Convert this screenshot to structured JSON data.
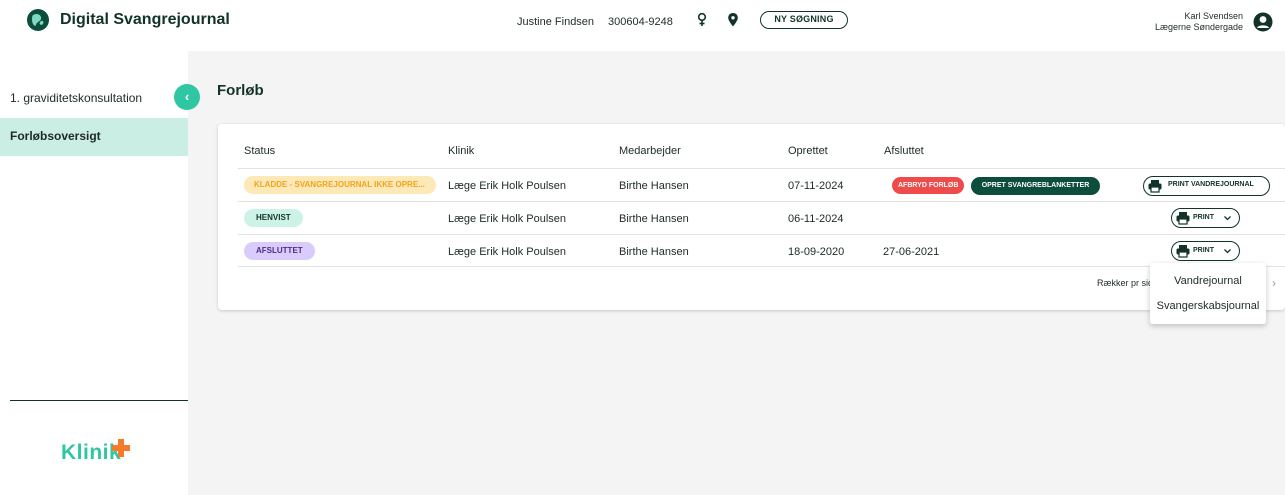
{
  "header": {
    "app_title": "Digital Svangrejournal",
    "patient_name": "Justine Findsen",
    "patient_cpr": "300604-9248",
    "new_search_label": "NY SØGNING",
    "user_name": "Karl Svendsen",
    "user_org": "Lægerne Søndergade"
  },
  "sidebar": {
    "items": [
      {
        "label": "1. graviditetskonsultation",
        "active": false
      },
      {
        "label": "Forløbsoversigt",
        "active": true
      }
    ],
    "collapse_icon": "chevron-left-icon",
    "brand_name": "Klinik"
  },
  "page": {
    "title": "Forløb"
  },
  "table": {
    "columns": [
      "Status",
      "Klinik",
      "Medarbejder",
      "Oprettet",
      "Afsluttet"
    ],
    "rows": [
      {
        "status": "KLADDE - SVANGREJOURNAL IKKE OPRE...",
        "klinik": "Læge Erik Holk Poulsen",
        "medarbejder": "Birthe Hansen",
        "oprettet": "07-11-2024",
        "afsluttet": "",
        "actions": {
          "afbryd_label": "AFBRYD FORLØB",
          "opret_label": "OPRET SVANGREBLANKETTER",
          "print_label": "PRINT VANDREJOURNAL"
        }
      },
      {
        "status": "HENVIST",
        "klinik": "Læge Erik Holk Poulsen",
        "medarbejder": "Birthe Hansen",
        "oprettet": "06-11-2024",
        "afsluttet": "",
        "actions": {
          "print_label": "PRINT"
        }
      },
      {
        "status": "AFSLUTTET",
        "klinik": "Læge Erik Holk Poulsen",
        "medarbejder": "Birthe Hansen",
        "oprettet": "18-09-2020",
        "afsluttet": "27-06-2021",
        "actions": {
          "print_label": "PRINT"
        }
      }
    ],
    "pagination": {
      "rows_per_page_label": "Rækker pr side"
    }
  },
  "print_menu": {
    "items": [
      "Vandrejournal",
      "Svangerskabsjournal"
    ]
  },
  "colors": {
    "brand_dark": "#0d4d3c",
    "accent_teal": "#2fc7a3",
    "active_nav": "#cbeee4",
    "draft_bg": "#fde9b8",
    "draft_text": "#f2a31a",
    "referred_bg": "#cdf3e6",
    "closed_bg": "#d9ccfa",
    "danger": "#ef4b4b"
  }
}
